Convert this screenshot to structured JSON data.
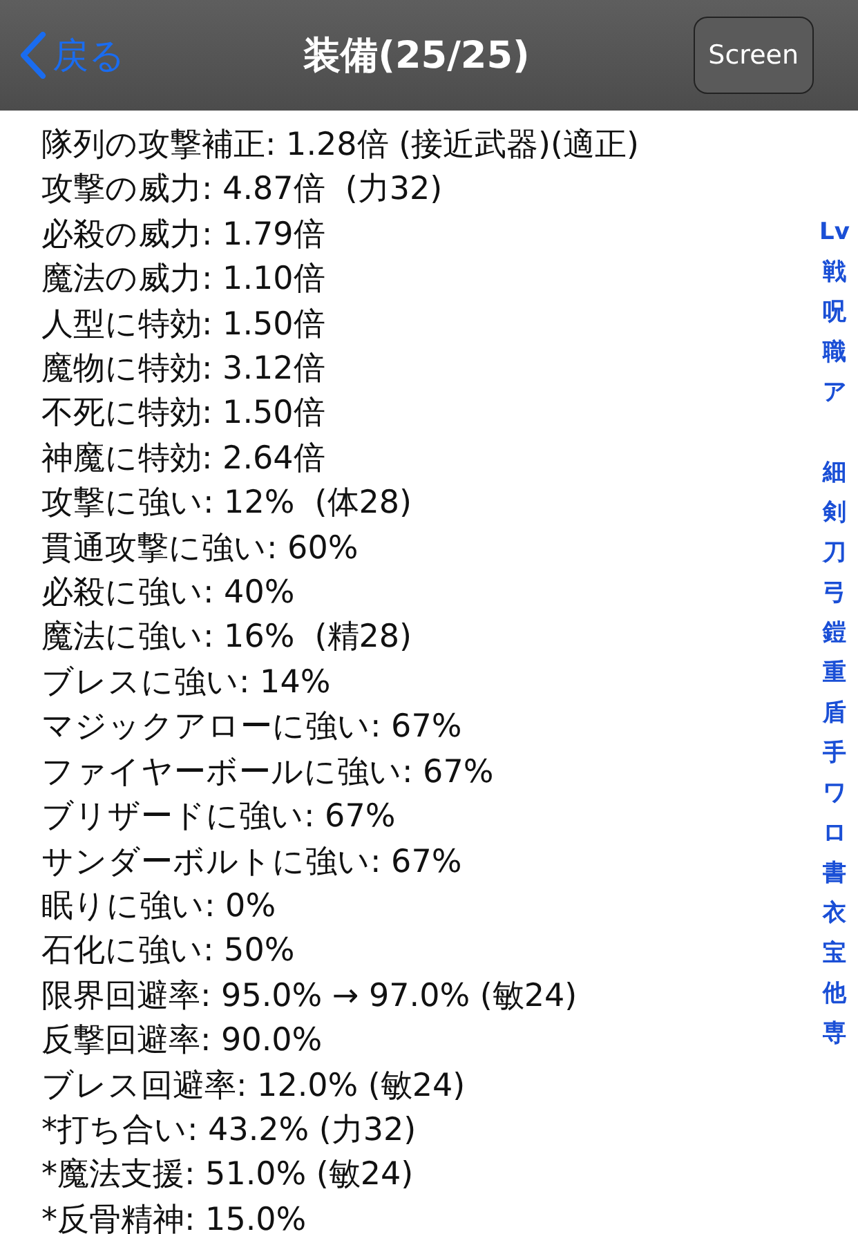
{
  "nav": {
    "back": "戻る",
    "title": "装備(25/25)",
    "action": "Screen"
  },
  "stats": [
    "隊列の攻撃補正: 1.28倍 (接近武器)(適正)",
    "攻撃の威力: 4.87倍  (力32)",
    "必殺の威力: 1.79倍",
    "魔法の威力: 1.10倍",
    "人型に特効: 1.50倍",
    "魔物に特効: 3.12倍",
    "不死に特効: 1.50倍",
    "神魔に特効: 2.64倍",
    "攻撃に強い: 12%  (体28)",
    "貫通攻撃に強い: 60%",
    "必殺に強い: 40%",
    "魔法に強い: 16%  (精28)",
    "ブレスに強い: 14%",
    "マジックアローに強い: 67%",
    "ファイヤーボールに強い: 67%",
    "ブリザードに強い: 67%",
    "サンダーボルトに強い: 67%",
    "眠りに強い: 0%",
    "石化に強い: 50%",
    "限界回避率: 95.0% → 97.0% (敏24)",
    "反撃回避率: 90.0%",
    "ブレス回避率: 12.0% (敏24)",
    "*打ち合い: 43.2% (力32)",
    "*魔法支援: 51.0% (敏24)",
    "*反骨精神: 15.0%"
  ],
  "index_groups": [
    [
      "Lv",
      "戦",
      "呪",
      "職",
      "ア"
    ],
    [
      "細",
      "剣",
      "刀",
      "弓",
      "鎧",
      "重",
      "盾",
      "手",
      "ワ",
      "ロ",
      "書",
      "衣",
      "宝",
      "他",
      "専"
    ]
  ]
}
